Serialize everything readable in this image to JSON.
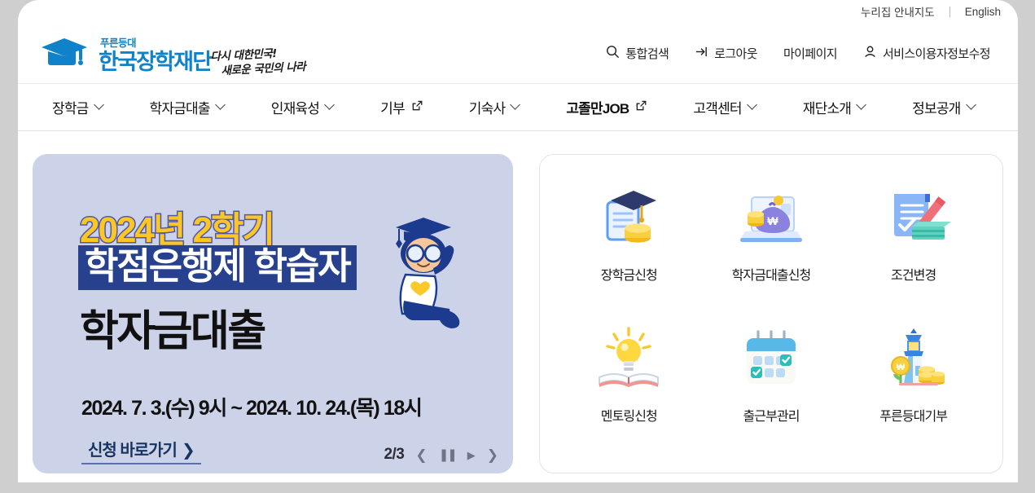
{
  "topbar": {
    "items": [
      {
        "label": "누리집 안내지도",
        "name": "sitemap-link"
      },
      {
        "label": "English",
        "name": "english-link"
      }
    ]
  },
  "header": {
    "logo": {
      "small_text": "푸른등대",
      "main_text": "한국장학재단",
      "icon": "graduation-cap-icon",
      "color": "#1082c9"
    },
    "slogan_line1": "다시 대한민국!",
    "slogan_line2": "새로운 국민의 나라",
    "utilities": [
      {
        "label": "통합검색",
        "icon": "search-icon",
        "name": "integrated-search"
      },
      {
        "label": "로그아웃",
        "icon": "logout-icon",
        "name": "logout"
      },
      {
        "label": "마이페이지",
        "icon": "",
        "name": "mypage"
      },
      {
        "label": "서비스이용자정보수정",
        "icon": "user-icon",
        "name": "user-info-edit"
      }
    ]
  },
  "gnb": {
    "items": [
      {
        "label": "장학금",
        "type": "dropdown"
      },
      {
        "label": "학자금대출",
        "type": "dropdown"
      },
      {
        "label": "인재육성",
        "type": "dropdown"
      },
      {
        "label": "기부",
        "type": "external"
      },
      {
        "label": "기숙사",
        "type": "dropdown"
      },
      {
        "label": "고졸만JOB",
        "type": "external"
      },
      {
        "label": "고객센터",
        "type": "dropdown"
      },
      {
        "label": "재단소개",
        "type": "dropdown"
      },
      {
        "label": "정보공개",
        "type": "dropdown"
      }
    ]
  },
  "banner": {
    "line1": "2024년 2학기",
    "line2": "학점은행제 학습자",
    "line3": "학자금대출",
    "date_range": "2024. 7. 3.(수) 9시 ~ 2024. 10. 24.(목) 18시",
    "cta_label": "신청 바로가기",
    "cta_arrow": "❯",
    "bg_color": "#ccd2e8",
    "line1_color": "#fdc625",
    "line2_bg": "#27418e",
    "carousel": {
      "counter": "2/3",
      "prev": "❮",
      "pause": "❚❚",
      "play": "▶",
      "next": "❯"
    }
  },
  "quick_links": {
    "items": [
      {
        "label": "장학금신청",
        "icon": "graduation-cap-document-coins-icon",
        "highlighted": false
      },
      {
        "label": "학자금대출신청",
        "icon": "money-bag-laptop-icon",
        "highlighted": true
      },
      {
        "label": "조건변경",
        "icon": "document-pencil-cash-icon",
        "highlighted": false
      },
      {
        "label": "멘토링신청",
        "icon": "lightbulb-book-icon",
        "highlighted": false
      },
      {
        "label": "출근부관리",
        "icon": "calendar-check-icon",
        "highlighted": false
      },
      {
        "label": "푸른등대기부",
        "icon": "lighthouse-coins-icon",
        "highlighted": false
      }
    ],
    "highlight_color": "#ff0000"
  }
}
